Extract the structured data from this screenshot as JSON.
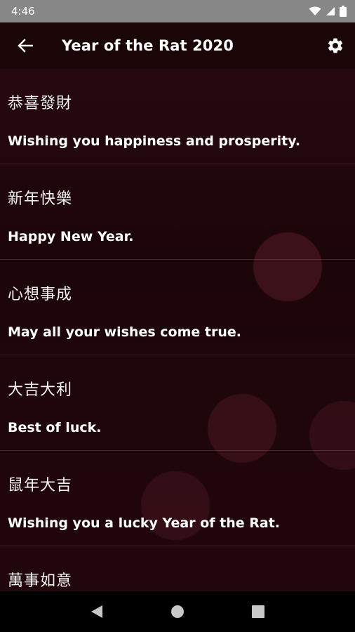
{
  "status_bar": {
    "time": "4:46",
    "icons": [
      "wifi-icon",
      "signal-icon",
      "battery-icon"
    ]
  },
  "app_bar": {
    "title": "Year of the Rat 2020",
    "back_icon": "arrow-left-icon",
    "settings_icon": "gear-icon"
  },
  "greetings": [
    {
      "chinese": "恭喜發財",
      "english": "Wishing you happiness and prosperity."
    },
    {
      "chinese": "新年快樂",
      "english": "Happy New Year."
    },
    {
      "chinese": "心想事成",
      "english": "May all your wishes come true."
    },
    {
      "chinese": "大吉大利",
      "english": "Best of luck."
    },
    {
      "chinese": "鼠年大吉",
      "english": "Wishing you a lucky Year of the Rat."
    },
    {
      "chinese": "萬事如意",
      "english": ""
    }
  ],
  "nav_bar": {
    "icons": [
      "back-triangle-icon",
      "home-circle-icon",
      "recents-square-icon"
    ]
  },
  "colors": {
    "status_bar": "#878787",
    "app_bar": "#1a0507",
    "background": "#1c0509",
    "text": "#ffffff"
  }
}
